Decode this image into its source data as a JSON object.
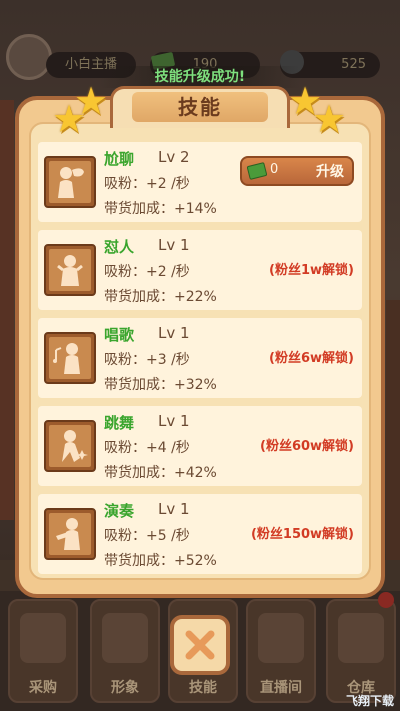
{
  "background": {
    "player_name": "小白主播",
    "money": "190",
    "fans": "525",
    "bottom_nav": [
      "采购",
      "形象",
      "技能",
      "直播间",
      "仓库"
    ]
  },
  "toast": "技能升级成功!",
  "panel": {
    "title": "技能",
    "skills": [
      {
        "name": "尬聊",
        "level": "Lv 2",
        "stat1": "吸粉：+2 /秒",
        "stat2": "带货加成：+14%",
        "upgrade_cost": "0",
        "upgrade_label": "升级",
        "icon": "chat-person-icon"
      },
      {
        "name": "怼人",
        "level": "Lv 1",
        "stat1": "吸粉：+2 /秒",
        "stat2": "带货加成：+22%",
        "lock": "(粉丝1w解锁)",
        "icon": "angry-person-icon"
      },
      {
        "name": "唱歌",
        "level": "Lv 1",
        "stat1": "吸粉：+3 /秒",
        "stat2": "带货加成：+32%",
        "lock": "(粉丝6w解锁)",
        "icon": "singing-person-icon"
      },
      {
        "name": "跳舞",
        "level": "Lv 1",
        "stat1": "吸粉：+4 /秒",
        "stat2": "带货加成：+42%",
        "lock": "(粉丝60w解锁)",
        "icon": "dancing-person-icon"
      },
      {
        "name": "演奏",
        "level": "Lv 1",
        "stat1": "吸粉：+5 /秒",
        "stat2": "带货加成：+52%",
        "lock": "(粉丝150w解锁)",
        "icon": "playing-person-icon"
      }
    ]
  },
  "watermark": "飞翔下载",
  "colors": {
    "accent": "#3aa52d",
    "lock": "#d23b24",
    "panel": "#f2c98f",
    "border": "#a9683b"
  }
}
